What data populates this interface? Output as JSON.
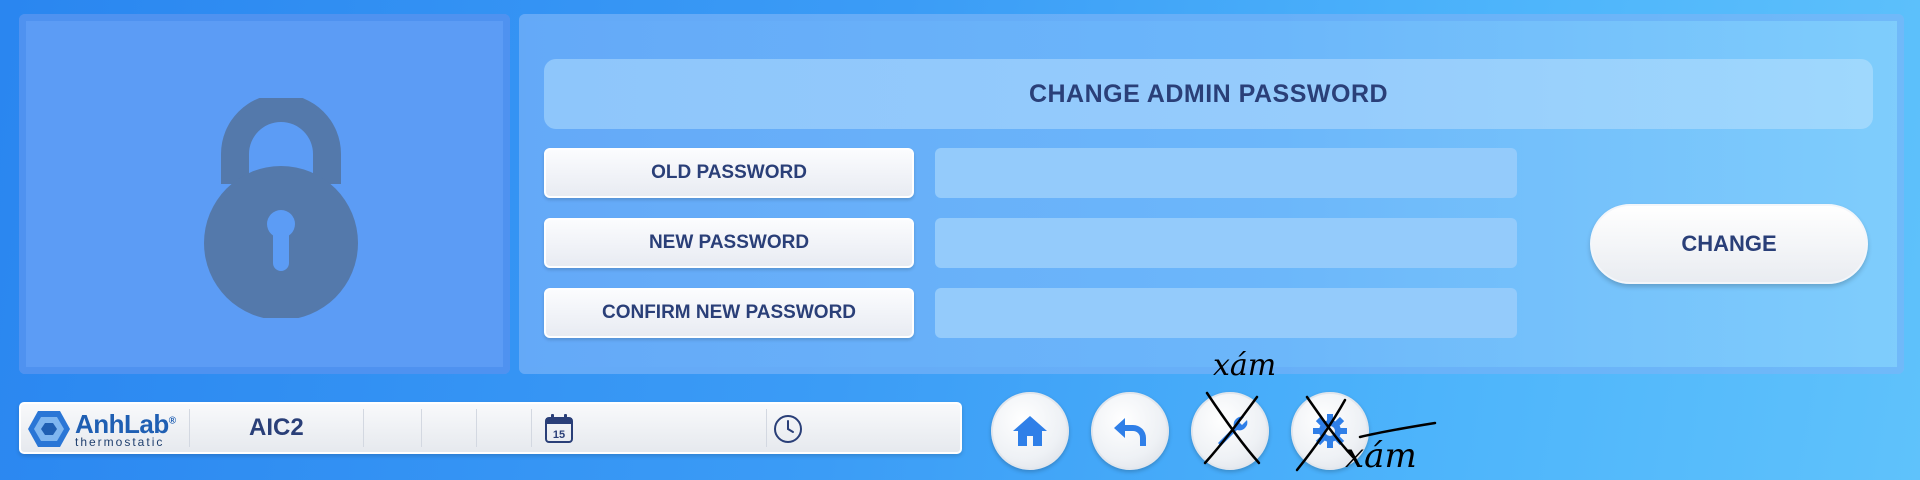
{
  "form": {
    "title": "CHANGE ADMIN PASSWORD",
    "fields": [
      {
        "label": "OLD PASSWORD",
        "value": ""
      },
      {
        "label": "NEW PASSWORD",
        "value": ""
      },
      {
        "label": "CONFIRM NEW PASSWORD",
        "value": ""
      }
    ],
    "submit_label": "CHANGE"
  },
  "status_bar": {
    "brand_name": "AnhLab",
    "brand_registered": "®",
    "brand_sub": "thermostatic",
    "device": "AIC2",
    "calendar_day": "15",
    "icons": [
      "calendar-icon",
      "clock-icon"
    ]
  },
  "nav_buttons": [
    {
      "name": "home-button",
      "icon": "home-icon"
    },
    {
      "name": "back-button",
      "icon": "back-arrow-icon"
    },
    {
      "name": "tools-button",
      "icon": "tools-icon"
    },
    {
      "name": "settings-button",
      "icon": "gear-icon"
    }
  ],
  "annotations": {
    "scribble_text_1": "xám",
    "scribble_text_2": "xám"
  },
  "colors": {
    "accent_text": "#2a3f78",
    "lock_icon": "#5479ab",
    "nav_icon": "#2f7fe8"
  }
}
